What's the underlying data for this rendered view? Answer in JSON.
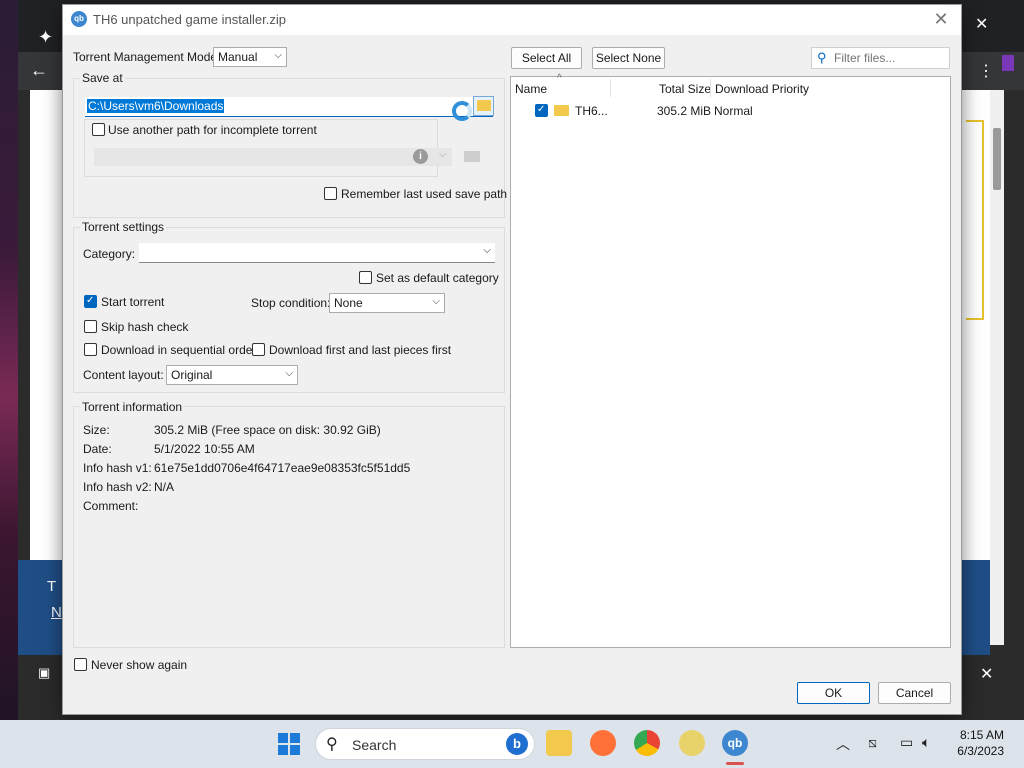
{
  "dialog": {
    "title": "TH6 unpatched game installer.zip",
    "app_icon_text": "qb"
  },
  "mgmt": {
    "label": "Torrent Management Mode:",
    "value": "Manual"
  },
  "save_at": {
    "group_title": "Save at",
    "path": "C:\\Users\\vm6\\Downloads",
    "incomplete_label": "Use another path for incomplete torrent",
    "remember_label": "Remember last used save path"
  },
  "settings": {
    "group_title": "Torrent settings",
    "category_label": "Category:",
    "category_value": "",
    "set_default_label": "Set as default category",
    "start_torrent_label": "Start torrent",
    "stop_condition_label": "Stop condition:",
    "stop_condition_value": "None",
    "skip_hash_label": "Skip hash check",
    "sequential_label": "Download in sequential order",
    "first_last_label": "Download first and last pieces first",
    "content_layout_label": "Content layout:",
    "content_layout_value": "Original"
  },
  "info": {
    "group_title": "Torrent information",
    "size_label": "Size:",
    "size_value": "305.2 MiB (Free space on disk: 30.92 GiB)",
    "date_label": "Date:",
    "date_value": "5/1/2022 10:55 AM",
    "hash1_label": "Info hash v1:",
    "hash1_value": "61e75e1dd0706e4f64717eae9e08353fc5f51dd5",
    "hash2_label": "Info hash v2:",
    "hash2_value": "N/A",
    "comment_label": "Comment:"
  },
  "files": {
    "select_all": "Select All",
    "select_none": "Select None",
    "filter_placeholder": "Filter files...",
    "col_name": "Name",
    "col_size": "Total Size",
    "col_priority": "Download Priority",
    "rows": [
      {
        "name": "TH6...",
        "size": "305.2 MiB",
        "priority": "Normal"
      }
    ]
  },
  "footer": {
    "never_show": "Never show again",
    "ok": "OK",
    "cancel": "Cancel"
  },
  "taskbar": {
    "search_text": "Search",
    "time": "8:15 AM",
    "date": "6/3/2023"
  },
  "background": {
    "page_text_t": "T",
    "page_text_n": "N"
  }
}
